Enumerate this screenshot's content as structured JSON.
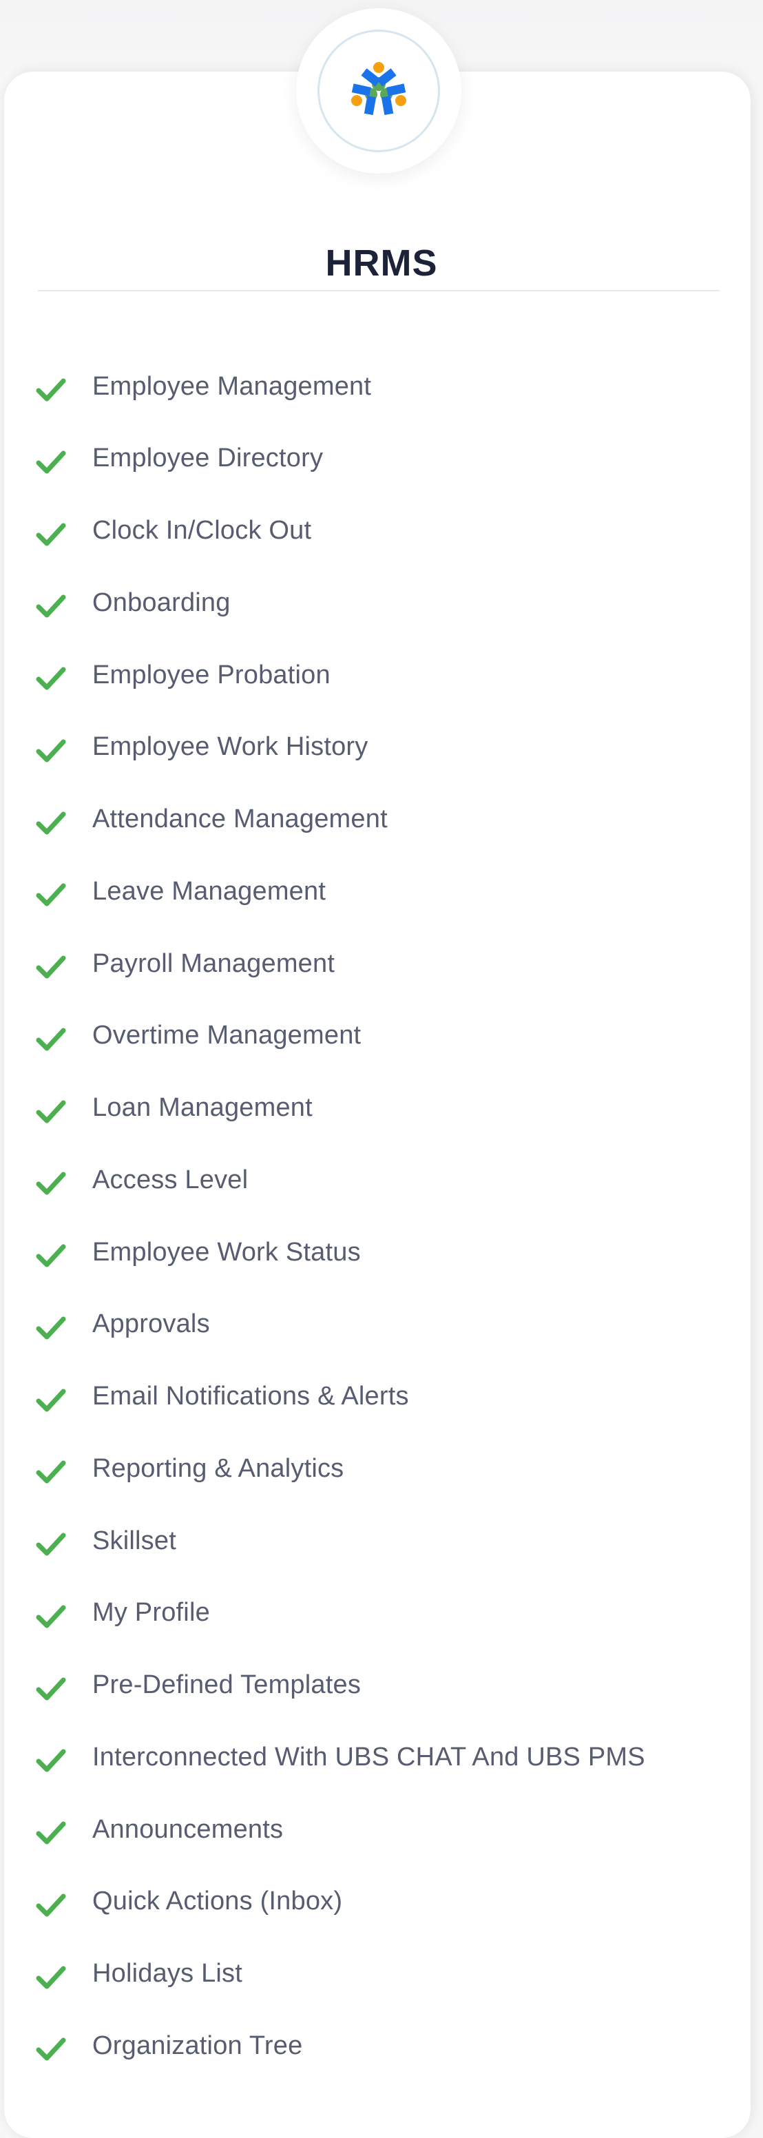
{
  "colors": {
    "check": "#4caf50",
    "title": "#1c2238",
    "text": "#575c70",
    "logo_blue": "#1a73e8",
    "logo_orange": "#f5a011",
    "logo_green": "#5aa85a",
    "ring": "#d5e6ee"
  },
  "logo": {
    "icon": "people-circle-logo-icon"
  },
  "header": {
    "title": "HRMS"
  },
  "features": {
    "icon": "check-icon",
    "items": [
      "Employee Management",
      "Employee Directory",
      "Clock In/Clock Out",
      "Onboarding",
      "Employee Probation",
      "Employee Work History",
      "Attendance Management",
      "Leave Management",
      "Payroll Management",
      "Overtime Management",
      "Loan Management",
      "Access Level",
      "Employee Work Status",
      "Approvals",
      "Email Notifications & Alerts",
      "Reporting & Analytics",
      "Skillset",
      "My Profile",
      "Pre-Defined Templates",
      "Interconnected With UBS CHAT And UBS PMS",
      "Announcements",
      "Quick Actions (Inbox)",
      "Holidays List",
      "Organization Tree"
    ]
  }
}
